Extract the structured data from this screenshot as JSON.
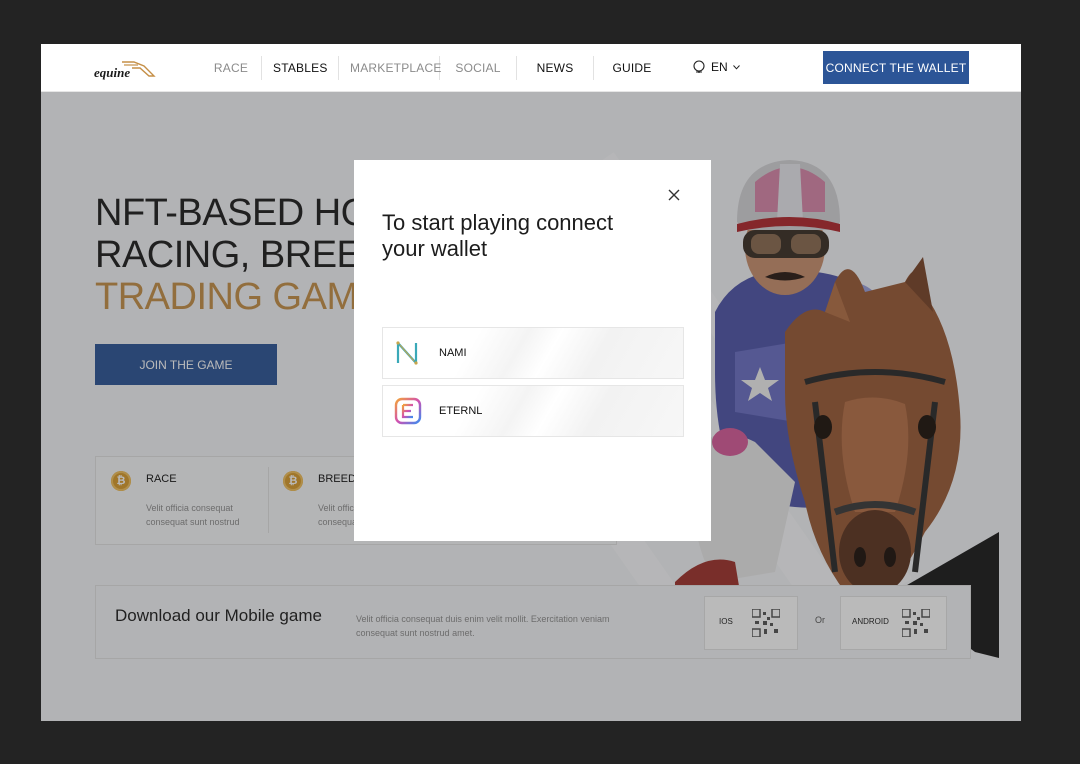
{
  "header": {
    "logo_text": "equine",
    "nav": [
      {
        "label": "RACE",
        "style": "dim"
      },
      {
        "label": "STABLES",
        "style": "dark"
      },
      {
        "label": "MARKETPLACE",
        "style": "dim"
      },
      {
        "label": "SOCIAL",
        "style": "dim"
      },
      {
        "label": "NEWS",
        "style": "dark"
      },
      {
        "label": "GUIDE",
        "style": "dark"
      }
    ],
    "language": "EN",
    "connect_label": "CONNECT THE WALLET"
  },
  "hero": {
    "title_line1": "NFT-BASED HORSE",
    "title_line2": "RACING, BREEDING",
    "title_line3": "TRADING GAME",
    "join_label": "JOIN THE GAME"
  },
  "features": [
    {
      "title": "RACE",
      "desc": "Velit officia consequat consequat sunt nostrud",
      "coin": "₿"
    },
    {
      "title": "BREED",
      "desc": "Velit officia consequat consequat sunt nostrud",
      "coin": "₿"
    }
  ],
  "download": {
    "title": "Download our Mobile game",
    "desc": "Velit officia consequat duis enim velit mollit. Exercitation veniam consequat sunt nostrud amet.",
    "ios_label": "IOS",
    "or_label": "Or",
    "android_label": "ANDROID"
  },
  "modal": {
    "title": "To start playing connect your wallet",
    "wallets": [
      {
        "label": "NAMI",
        "icon": "nami-icon"
      },
      {
        "label": "ETERNL",
        "icon": "eternl-icon"
      }
    ]
  },
  "colors": {
    "accent": "#2c5597",
    "gold": "#c58f47"
  }
}
